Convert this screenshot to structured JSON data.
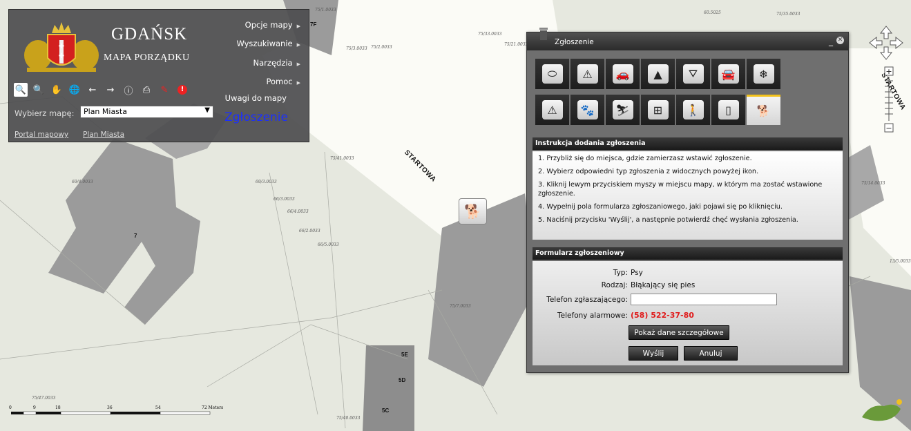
{
  "map": {
    "parcels": [
      "75/1.0033",
      "75/2.0033",
      "75/3.0033",
      "75/33.0033",
      "75/35.0033",
      "75/21.0033",
      "75/41.0033",
      "75/14.0033",
      "13/5.0033",
      "69/4.0033",
      "69/3.0033",
      "66/3.0033",
      "66/4.0033",
      "66/2.0033",
      "66/5.0033",
      "75/7.0033",
      "75/47.0033",
      "75/40.0033",
      "60.5025"
    ],
    "buildings": [
      "7F",
      "7",
      "5E",
      "5D",
      "5C"
    ],
    "streets": [
      "STARTOWA",
      "STARTOWA"
    ],
    "scale_ticks": [
      "0",
      "9",
      "18",
      "36",
      "54",
      "72 Meters"
    ]
  },
  "panel": {
    "city": "GDAŃSK",
    "subtitle": "MAPA PORZĄDKU",
    "menu": [
      {
        "label": "Opcje mapy",
        "icon": "chevron-right-icon"
      },
      {
        "label": "Wyszukiwanie",
        "icon": "chevron-right-icon"
      },
      {
        "label": "Narzędzia",
        "icon": "chevron-right-icon"
      },
      {
        "label": "Pomoc",
        "icon": "chevron-right-icon"
      }
    ],
    "uwagi": "Uwagi do mapy",
    "zgloszenie": "Zgłoszenie",
    "select_label": "Wybierz mapę:",
    "select_value": "Plan Miasta",
    "links": [
      "Portal mapowy",
      "Plan Miasta"
    ],
    "tools": [
      "zoom-in-icon",
      "zoom-out-icon",
      "pan-hand-icon",
      "globe-icon",
      "back-arrow-icon",
      "forward-arrow-icon",
      "info-icon",
      "print-icon",
      "measure-icon",
      "alert-icon"
    ]
  },
  "dialog": {
    "title": "Zgłoszenie",
    "categories_row1": [
      "ellipse-icon",
      "road-works-icon",
      "car-water-icon",
      "traffic-cone-icon",
      "water-tap-icon",
      "car-icon",
      "snowflake-icon"
    ],
    "categories_row2": [
      "warning-icon",
      "paw-icon",
      "slip-icon",
      "electric-box-icon",
      "graffiti-person-icon",
      "spray-can-icon",
      "dog-icon"
    ],
    "selected_category": "dog-icon",
    "instr_head": "Instrukcja dodania zgłoszenia",
    "instructions": [
      "1. Przybliż się do miejsca, gdzie zamierzasz wstawić zgłoszenie.",
      "2. Wybierz odpowiedni typ zgłoszenia z widocznych powyżej ikon.",
      "3. Kliknij lewym przyciskiem myszy w miejscu mapy, w którym ma zostać wstawione zgłoszenie.",
      "4. Wypełnij pola formularza zgłoszaniowego, jaki pojawi się po kliknięciu.",
      "5. Naciśnij przycisku 'Wyślij', a następnie potwierdź chęć wysłania zgłoszenia."
    ],
    "form_head": "Formularz zgłoszeniowy",
    "form": {
      "typ_label": "Typ:",
      "typ_value": "Psy",
      "rodzaj_label": "Rodzaj:",
      "rodzaj_value": "Błąkający się pies",
      "phone_label": "Telefon zgłaszającego:",
      "phone_value": "",
      "alarm_label": "Telefony alarmowe:",
      "alarm_value": "(58) 522-37-80"
    },
    "details_btn": "Pokaż dane szczegółowe",
    "send_btn": "Wyślij",
    "cancel_btn": "Anuluj"
  },
  "colors": {
    "panel_bg": "#4e4e50",
    "link_blue": "#1b2fff",
    "alarm_red": "#e01b1b",
    "building_gray": "#9b9b9b",
    "selected_tab": "#f3c21b"
  }
}
